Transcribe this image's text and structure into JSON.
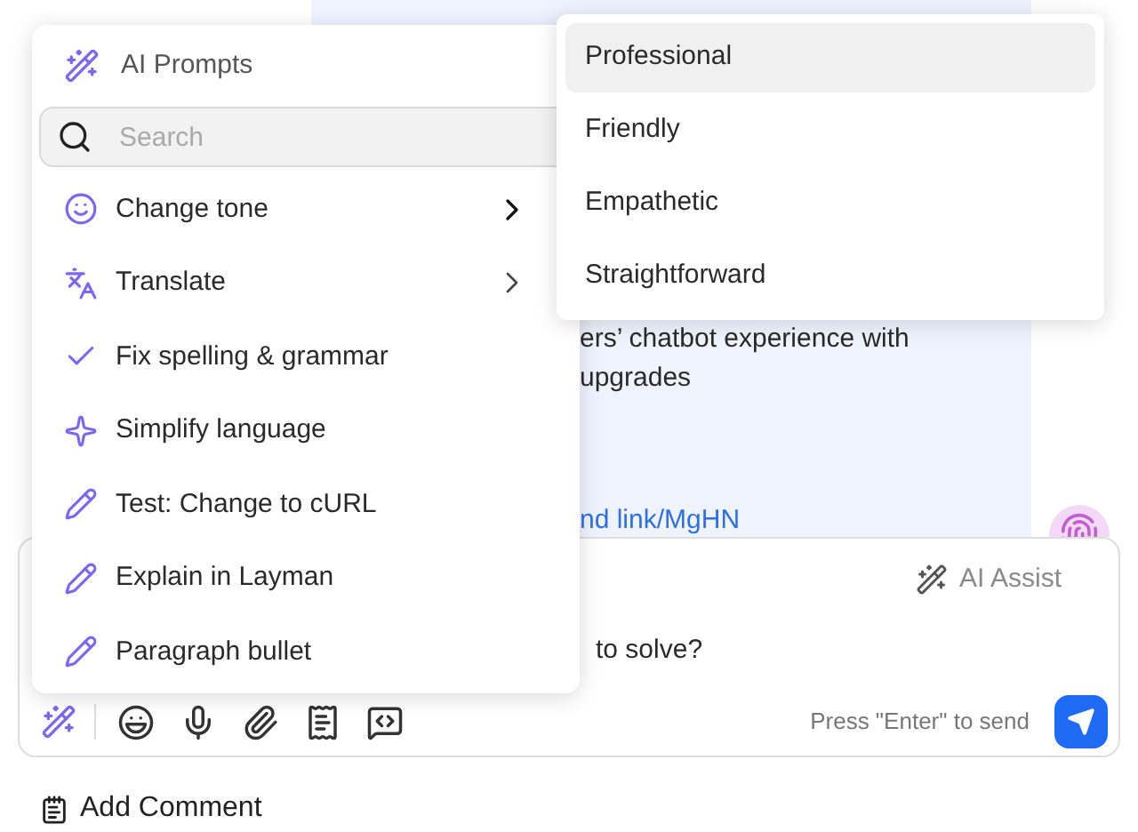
{
  "message": {
    "lines": [
      "ers’ chatbot experience with",
      "upgrades"
    ],
    "link": "nd link/MgHN"
  },
  "composer": {
    "ai_assist": "AI Assist",
    "text": "to solve?",
    "hint": "Press \"Enter\" to send"
  },
  "add_comment": "Add Comment",
  "ai_menu": {
    "title": "AI Prompts",
    "search": {
      "placeholder": "Search"
    },
    "items": [
      {
        "label": "Change tone",
        "kind": "submenu",
        "expanded": true
      },
      {
        "label": "Translate",
        "kind": "submenu",
        "expanded": false
      },
      {
        "label": "Fix spelling & grammar",
        "kind": "action"
      },
      {
        "label": "Simplify language",
        "kind": "action"
      },
      {
        "label": "Test: Change to cURL",
        "kind": "action"
      },
      {
        "label": "Explain in Layman",
        "kind": "action"
      },
      {
        "label": "Paragraph bullet",
        "kind": "action"
      }
    ]
  },
  "tone_menu": {
    "items": [
      {
        "label": "Professional",
        "selected": true
      },
      {
        "label": "Friendly",
        "selected": false
      },
      {
        "label": "Empathetic",
        "selected": false
      },
      {
        "label": "Straightforward",
        "selected": false
      }
    ]
  }
}
